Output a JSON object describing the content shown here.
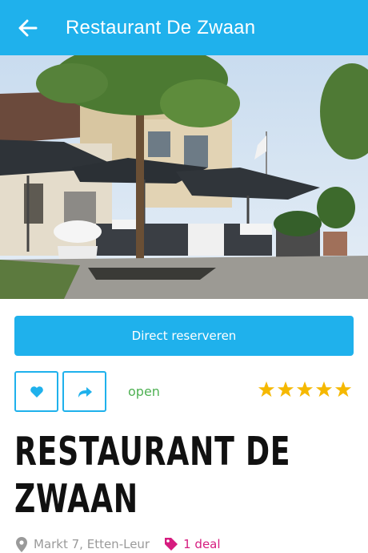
{
  "appbar": {
    "title": "Restaurant De Zwaan",
    "back_icon": "arrow-left-icon"
  },
  "hero": {
    "description_icon": "restaurant-terrace-photo"
  },
  "actions": {
    "reserve_label": "Direct reserveren",
    "favorite_icon": "heart-icon",
    "share_icon": "share-arrow-icon",
    "status": "open"
  },
  "rating": {
    "stars": 5,
    "max": 5,
    "color": "#f5b800"
  },
  "restaurant": {
    "name_line1": "RESTAURANT DE",
    "name_line2": "ZWAAN",
    "address": "Markt 7, Etten-Leur",
    "deal_label": "1 deal"
  },
  "colors": {
    "accent": "#1fb1ec",
    "open": "#4fb153",
    "deal": "#d61c7f"
  }
}
